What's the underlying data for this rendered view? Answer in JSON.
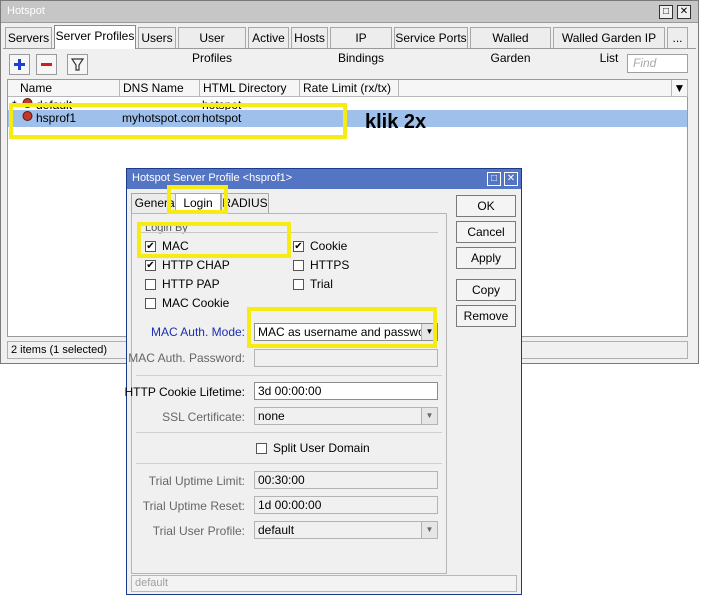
{
  "main_window": {
    "title": "Hotspot",
    "tabs": [
      {
        "label": "Servers",
        "active": false
      },
      {
        "label": "Server Profiles",
        "active": true
      },
      {
        "label": "Users",
        "active": false
      },
      {
        "label": "User Profiles",
        "active": false
      },
      {
        "label": "Active",
        "active": false
      },
      {
        "label": "Hosts",
        "active": false
      },
      {
        "label": "IP Bindings",
        "active": false
      },
      {
        "label": "Service Ports",
        "active": false
      },
      {
        "label": "Walled Garden",
        "active": false
      },
      {
        "label": "Walled Garden IP List",
        "active": false
      },
      {
        "label": "...",
        "active": false
      }
    ],
    "toolbar": {
      "add_icon": "plus-icon",
      "remove_icon": "minus-icon",
      "filter_icon": "funnel-icon"
    },
    "find_placeholder": "Find",
    "table": {
      "columns": [
        "Name",
        "DNS Name",
        "HTML Directory",
        "Rate Limit (rx/tx)"
      ],
      "rows": [
        {
          "marker": "*",
          "name": "default",
          "dns_name": "",
          "html_directory": "hotspot",
          "rate_limit": ""
        },
        {
          "marker": "",
          "name": "hsprof1",
          "dns_name": "myhotspot.com",
          "html_directory": "hotspot",
          "rate_limit": ""
        }
      ]
    },
    "status": "2 items (1 selected)"
  },
  "annotation": {
    "text": "klik 2x",
    "highlight_color": "#f6ec14"
  },
  "dialog": {
    "title": "Hotspot Server Profile <hsprof1>",
    "tabs": [
      {
        "label": "General",
        "active": false
      },
      {
        "label": "Login",
        "active": true
      },
      {
        "label": "RADIUS",
        "active": false
      }
    ],
    "login_by_legend": "Login By",
    "login_options": {
      "mac": {
        "label": "MAC",
        "checked": true
      },
      "cookie": {
        "label": "Cookie",
        "checked": true
      },
      "http_chap": {
        "label": "HTTP CHAP",
        "checked": true
      },
      "https": {
        "label": "HTTPS",
        "checked": false
      },
      "http_pap": {
        "label": "HTTP PAP",
        "checked": false
      },
      "trial": {
        "label": "Trial",
        "checked": false
      },
      "mac_cookie": {
        "label": "MAC Cookie",
        "checked": false
      }
    },
    "mac_auth_mode": {
      "label": "MAC Auth. Mode:",
      "value": "MAC as username and password"
    },
    "mac_auth_password": {
      "label": "MAC Auth. Password:",
      "value": ""
    },
    "http_cookie_lifetime": {
      "label": "HTTP Cookie Lifetime:",
      "value": "3d 00:00:00"
    },
    "ssl_certificate": {
      "label": "SSL Certificate:",
      "value": "none"
    },
    "split_user_domain": {
      "label": "Split User Domain",
      "checked": false
    },
    "trial_uptime_limit": {
      "label": "Trial Uptime Limit:",
      "value": "00:30:00"
    },
    "trial_uptime_reset": {
      "label": "Trial Uptime Reset:",
      "value": "1d 00:00:00"
    },
    "trial_user_profile": {
      "label": "Trial User Profile:",
      "value": "default"
    },
    "buttons": {
      "ok": "OK",
      "cancel": "Cancel",
      "apply": "Apply",
      "copy": "Copy",
      "remove": "Remove"
    },
    "status": "default"
  }
}
